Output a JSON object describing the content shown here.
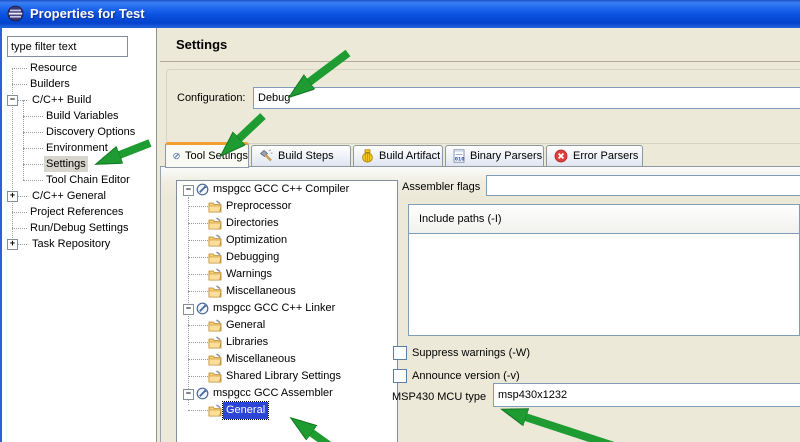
{
  "window": {
    "title": "Properties for Test"
  },
  "sidebar": {
    "filter_value": "type filter text",
    "items": [
      {
        "label": "Resource"
      },
      {
        "label": "Builders"
      },
      {
        "label": "C/C++ Build"
      },
      {
        "label": "Build Variables"
      },
      {
        "label": "Discovery Options"
      },
      {
        "label": "Environment"
      },
      {
        "label": "Settings"
      },
      {
        "label": "Tool Chain Editor"
      },
      {
        "label": "C/C++ General"
      },
      {
        "label": "Project References"
      },
      {
        "label": "Run/Debug Settings"
      },
      {
        "label": "Task Repository"
      }
    ]
  },
  "main": {
    "heading": "Settings",
    "configuration": {
      "label": "Configuration:",
      "value": "Debug"
    },
    "tabs": [
      {
        "label": "Tool Settings",
        "icon": "wrench-icon",
        "active": true
      },
      {
        "label": "Build Steps",
        "icon": "hammer-icon",
        "active": false
      },
      {
        "label": "Build Artifact",
        "icon": "artifact-icon",
        "active": false
      },
      {
        "label": "Binary Parsers",
        "icon": "binary-doc-icon",
        "active": false
      },
      {
        "label": "Error Parsers",
        "icon": "error-circle-icon",
        "active": false
      }
    ],
    "tool_tree": [
      {
        "label": "mspgcc GCC C++ Compiler"
      },
      {
        "label": "Preprocessor"
      },
      {
        "label": "Directories"
      },
      {
        "label": "Optimization"
      },
      {
        "label": "Debugging"
      },
      {
        "label": "Warnings"
      },
      {
        "label": "Miscellaneous"
      },
      {
        "label": "mspgcc GCC C++ Linker"
      },
      {
        "label": "General"
      },
      {
        "label": "Libraries"
      },
      {
        "label": "Miscellaneous"
      },
      {
        "label": "Shared Library Settings"
      },
      {
        "label": "mspgcc GCC Assembler"
      },
      {
        "label": "General"
      }
    ],
    "panel": {
      "assembler_flags_label": "Assembler flags",
      "assembler_flags_value": "",
      "include_paths_header": "Include paths (-I)",
      "suppress_warnings_label": "Suppress warnings (-W)",
      "announce_version_label": "Announce version (-v)",
      "mcu_label": "MSP430 MCU type",
      "mcu_value": "msp430x1232"
    }
  },
  "colors": {
    "titlebar_blue": "#0A50E0",
    "background_beige": "#ECE9D8",
    "field_border": "#7F9DB9",
    "selection_blue": "#2B45D6",
    "arrow_green": "#1E9C31",
    "active_tab_accent": "#F0A030"
  }
}
